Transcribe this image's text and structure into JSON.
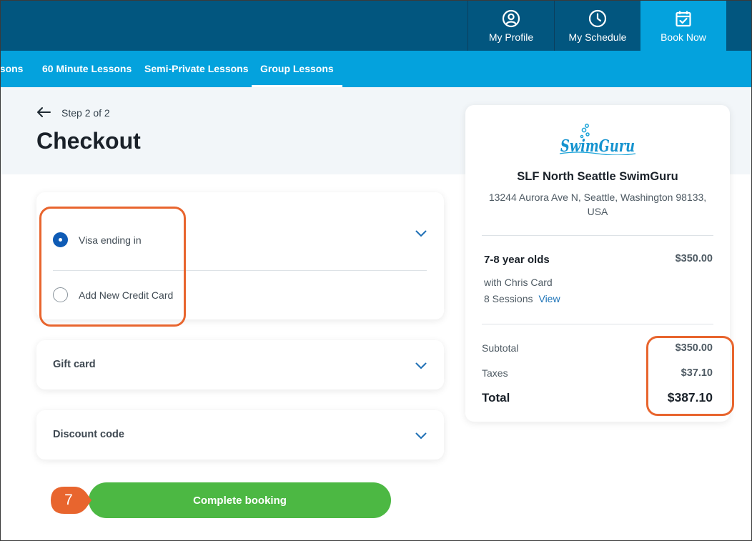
{
  "header": {
    "nav": [
      {
        "label": "My Profile",
        "icon": "user-circle-icon"
      },
      {
        "label": "My Schedule",
        "icon": "clock-icon"
      },
      {
        "label": "Book Now",
        "icon": "calendar-check-icon",
        "active": true
      }
    ]
  },
  "subnav": {
    "tabs": [
      {
        "label": "ssons"
      },
      {
        "label": "60 Minute Lessons"
      },
      {
        "label": "Semi-Private Lessons"
      },
      {
        "label": "Group Lessons",
        "active": true
      }
    ]
  },
  "checkout": {
    "step": "Step 2 of 2",
    "title": "Checkout",
    "payment": {
      "options": [
        {
          "label": "Visa ending in",
          "selected": true
        },
        {
          "label": "Add New Credit Card",
          "selected": false
        }
      ]
    },
    "gift_card_label": "Gift card",
    "discount_label": "Discount code",
    "complete_label": "Complete booking",
    "step_badge": "7"
  },
  "summary": {
    "logo_text": "SwimGuru",
    "location_name": "SLF North Seattle SwimGuru",
    "address": "13244 Aurora Ave N, Seattle, Washington 98133, USA",
    "item": {
      "name": "7-8 year olds",
      "price": "$350.00",
      "instructor": "with Chris Card",
      "sessions": "8 Sessions",
      "view_label": "View"
    },
    "subtotal_label": "Subtotal",
    "subtotal": "$350.00",
    "taxes_label": "Taxes",
    "taxes": "$37.10",
    "total_label": "Total",
    "total": "$387.10"
  },
  "colors": {
    "header": "#02567f",
    "accent": "#04a2dd",
    "highlight": "#e8652e",
    "primary_button": "#4cb843",
    "radio_selected": "#0f5bb5"
  }
}
